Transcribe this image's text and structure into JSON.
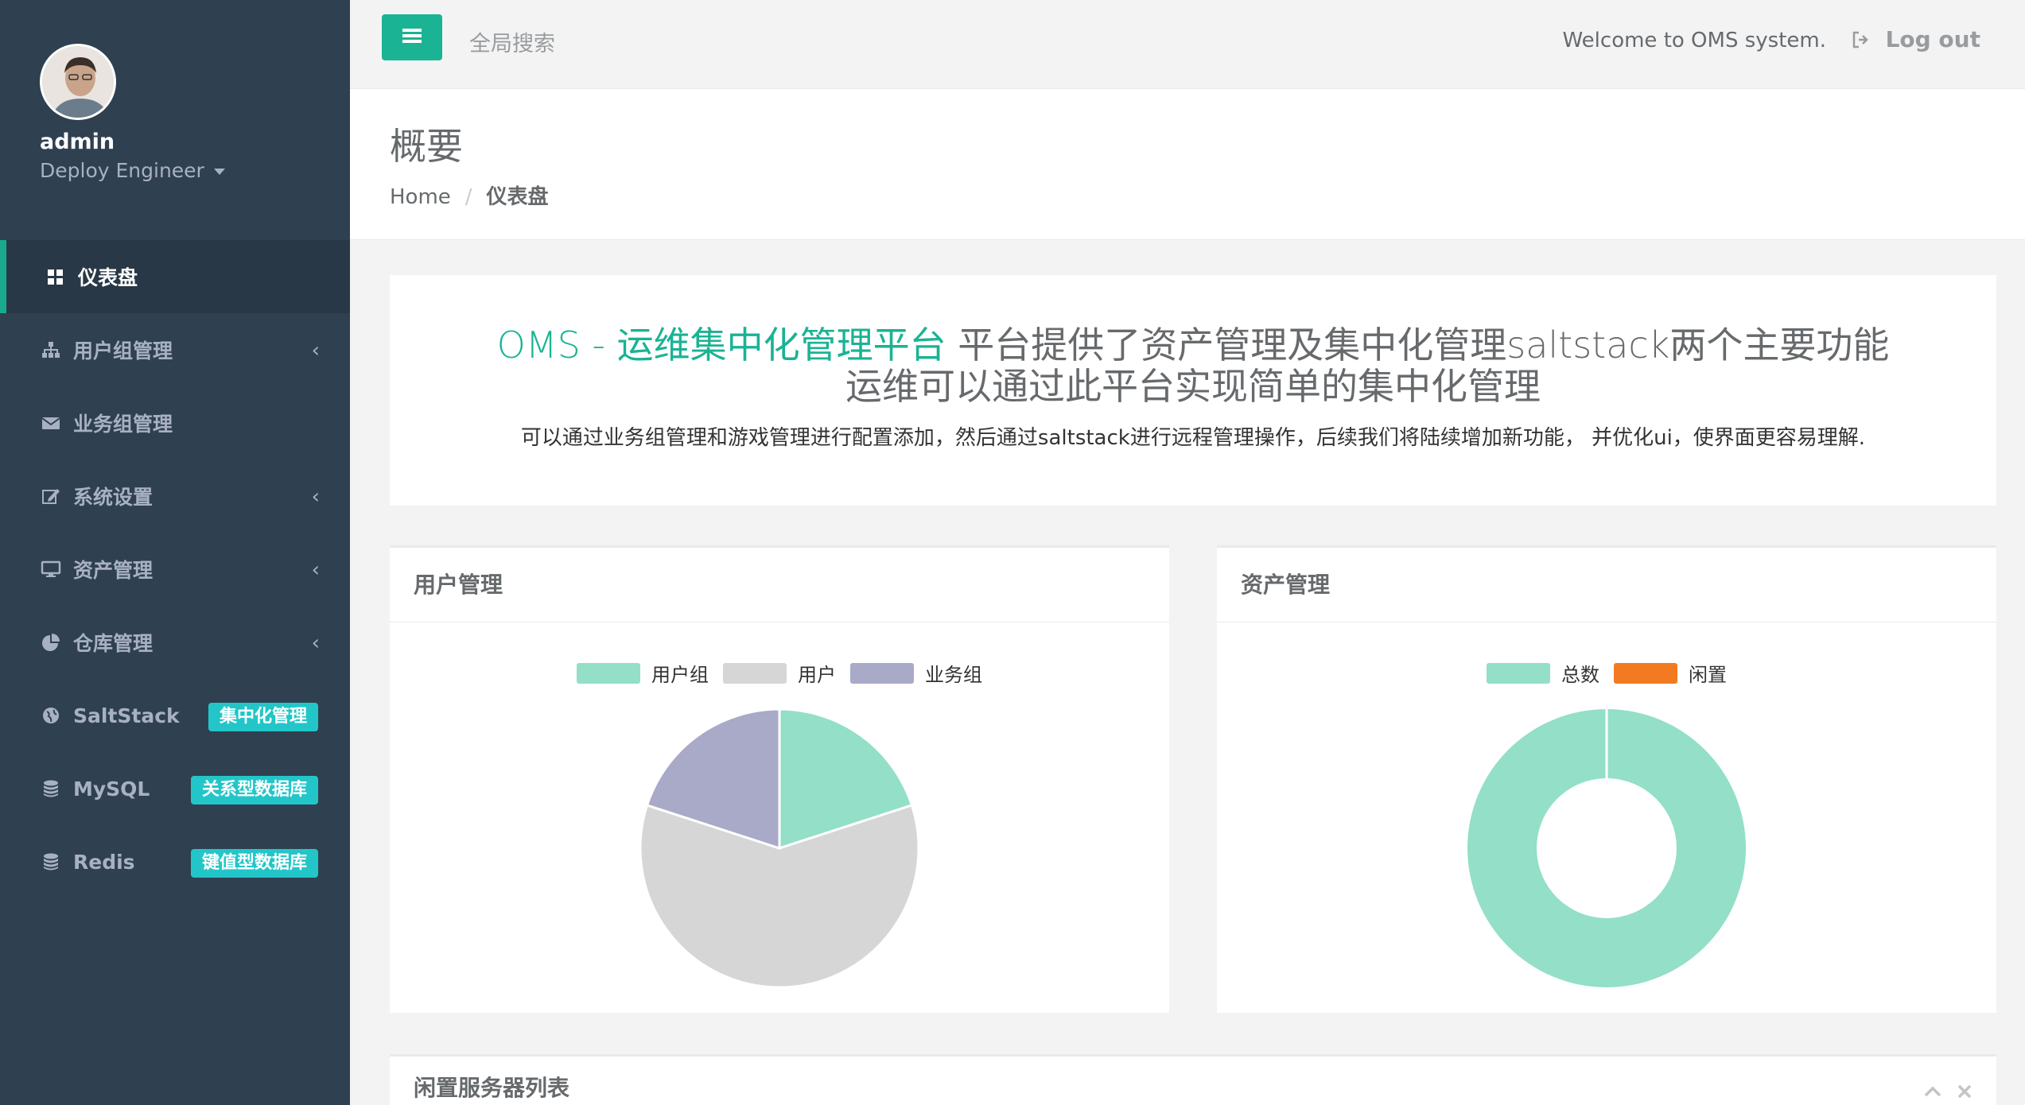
{
  "profile": {
    "name": "admin",
    "role": "Deploy Engineer"
  },
  "sidebar": {
    "items": [
      {
        "label": "仪表盘",
        "icon": "dashboard-icon"
      },
      {
        "label": "用户组管理",
        "icon": "sitemap-icon"
      },
      {
        "label": "业务组管理",
        "icon": "envelope-icon"
      },
      {
        "label": "系统设置",
        "icon": "edit-icon"
      },
      {
        "label": "资产管理",
        "icon": "desktop-icon"
      },
      {
        "label": "仓库管理",
        "icon": "pie-chart-icon"
      },
      {
        "label": "SaltStack",
        "icon": "globe-icon",
        "badge": "集中化管理"
      },
      {
        "label": "MySQL",
        "icon": "database-icon",
        "badge": "关系型数据库"
      },
      {
        "label": "Redis",
        "icon": "database-icon",
        "badge": "键值型数据库"
      }
    ]
  },
  "topbar": {
    "search_label": "全局搜索",
    "welcome": "Welcome to OMS system.",
    "logout": "Log out"
  },
  "heading": {
    "title": "概要",
    "breadcrumb_home": "Home",
    "breadcrumb_current": "仪表盘"
  },
  "hero": {
    "accent": "OMS - 运维集中化管理平台",
    "line1_rest": " 平台提供了资产管理及集中化管理saltstack两个主要功能",
    "line2": "运维可以通过此平台实现简单的集中化管理",
    "description": "可以通过业务组管理和游戏管理进行配置添加，然后通过saltstack进行远程管理操作，后续我们将陆续增加新功能， 并优化ui，使界面更容易理解."
  },
  "panels": {
    "users_title": "用户管理",
    "assets_title": "资产管理",
    "idle_title": "闲置服务器列表"
  },
  "colors": {
    "accent": "#1ab394",
    "badge": "#23c6c8",
    "sidebar": "#2f4050"
  },
  "chart_data": [
    {
      "type": "pie",
      "categories": [
        "用户组",
        "用户",
        "业务组"
      ],
      "values": [
        1,
        3,
        1
      ],
      "colors": [
        "#93dfc8",
        "#d6d6d6",
        "#a8aac8"
      ]
    },
    {
      "type": "pie",
      "variant": "donut",
      "categories": [
        "总数",
        "闲置"
      ],
      "values": [
        1,
        0
      ],
      "colors": [
        "#93dfc8",
        "#f27a20"
      ]
    }
  ]
}
